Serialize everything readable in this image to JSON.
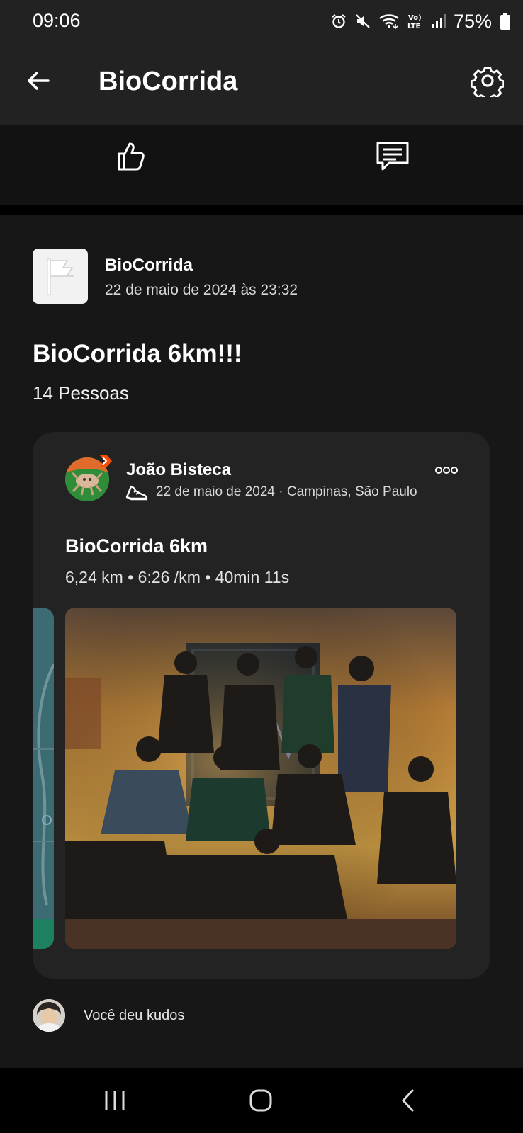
{
  "status_bar": {
    "time": "09:06",
    "battery": "75%",
    "icons": [
      "alarm-icon",
      "mute-icon",
      "wifi-icon",
      "volte-icon",
      "signal-icon",
      "battery-icon"
    ]
  },
  "app_bar": {
    "title": "BioCorrida",
    "back_icon": "arrow-left-icon",
    "settings_icon": "gear-icon"
  },
  "actions": {
    "kudos_icon": "thumbs-up-icon",
    "comment_icon": "comment-icon"
  },
  "post": {
    "club_name": "BioCorrida",
    "date": "22 de maio de 2024 às 23:32",
    "title": "BioCorrida 6km!!!",
    "people": "14 Pessoas",
    "activity": {
      "athlete": "João Bisteca",
      "meta": "22 de maio de 2024 · Campinas, São Paulo",
      "title": "BioCorrida 6km",
      "stats": "6,24 km • 6:26 /km • 40min 11s"
    },
    "kudos_text": "Você deu kudos"
  },
  "colors": {
    "background": "#121212",
    "app_bar": "#222222",
    "card": "#232323",
    "accent": "#fc4c02"
  }
}
